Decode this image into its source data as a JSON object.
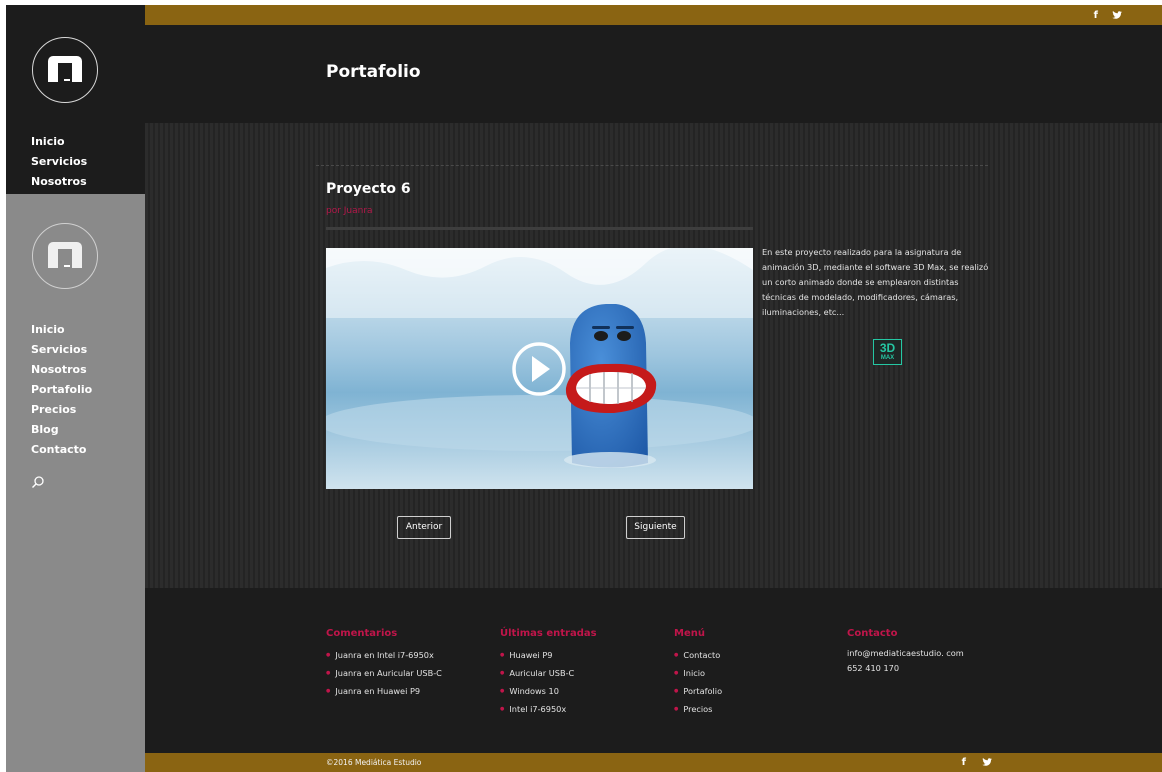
{
  "sidebar": {
    "nav_top": [
      "Inicio",
      "Servicios",
      "Nosotros"
    ],
    "nav_bottom": [
      "Inicio",
      "Servicios",
      "Nosotros",
      "Portafolio",
      "Precios",
      "Blog",
      "Contacto"
    ],
    "search_icon": "search-icon"
  },
  "topbar": {
    "facebook": "f",
    "twitter": "♥",
    "icons": [
      "facebook-icon",
      "twitter-icon"
    ]
  },
  "page": {
    "title": "Portafolio"
  },
  "post": {
    "title": "Proyecto 6",
    "author": "por Juanra",
    "description": "En este proyecto realizado para la asignatura de animación 3D, mediante el software 3D Max, se realizó un corto animado donde se emplearon distintas técnicas de modelado, modificadores, cámaras, iluminaciones, etc...",
    "badge_main": "3D",
    "badge_sub": "MAX",
    "prev_label": "Anterior",
    "next_label": "Siguiente"
  },
  "footer": {
    "comments": {
      "title": "Comentarios",
      "items": [
        "Juanra en Intel i7-6950x",
        "Juanra en Auricular USB-C",
        "Juanra en Huawei P9"
      ]
    },
    "latest": {
      "title": "Últimas entradas",
      "items": [
        "Huawei P9",
        "Auricular USB-C",
        "Windows 10",
        "Intel i7-6950x"
      ]
    },
    "menu": {
      "title": "Menú",
      "items": [
        "Contacto",
        "Inicio",
        "Portafolio",
        "Precios"
      ]
    },
    "contact": {
      "title": "Contacto",
      "items": [
        "info@mediaticaestudio. com",
        "652 410 170"
      ]
    },
    "copyright": "©2016 Mediática Estudio"
  },
  "colors": {
    "accent": "#c0154a",
    "bar": "#8a6412",
    "badge": "#25c7a3"
  }
}
